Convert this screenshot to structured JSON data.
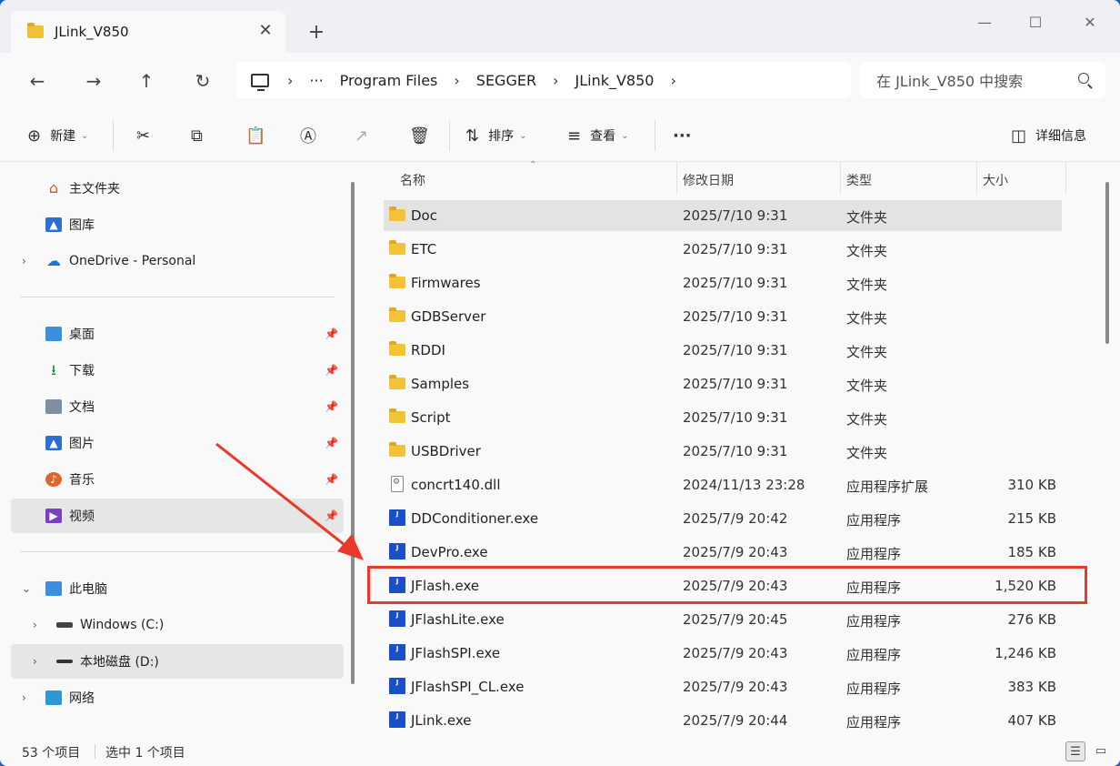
{
  "tab": {
    "title": "JLink_V850",
    "close": "✕",
    "new_tab": "+"
  },
  "window_controls": {
    "minimize": "—",
    "maximize": "☐",
    "close": "✕"
  },
  "nav": {
    "back": "←",
    "forward": "→",
    "up": "↑",
    "refresh": "↻"
  },
  "address": {
    "more": "···",
    "sep": "›",
    "crumbs": [
      "Program Files",
      "SEGGER",
      "JLink_V850"
    ]
  },
  "search": {
    "placeholder": "在 JLink_V850 中搜索"
  },
  "commands": {
    "new": "新建",
    "sort": "排序",
    "view": "查看",
    "more": "···",
    "details": "详细信息"
  },
  "sidebar": {
    "quick": [
      {
        "label": "主文件夹"
      },
      {
        "label": "图库"
      },
      {
        "label": "OneDrive - Personal"
      }
    ],
    "pinned": [
      {
        "label": "桌面"
      },
      {
        "label": "下载"
      },
      {
        "label": "文档"
      },
      {
        "label": "图片"
      },
      {
        "label": "音乐"
      },
      {
        "label": "视频"
      }
    ],
    "pc": [
      {
        "label": "此电脑"
      },
      {
        "label": "Windows (C:)"
      },
      {
        "label": "本地磁盘 (D:)"
      },
      {
        "label": "网络"
      }
    ]
  },
  "columns": {
    "name": "名称",
    "date": "修改日期",
    "type": "类型",
    "size": "大小"
  },
  "files": [
    {
      "name": "Doc",
      "date": "2025/7/10 9:31",
      "type": "文件夹",
      "size": "",
      "kind": "folder"
    },
    {
      "name": "ETC",
      "date": "2025/7/10 9:31",
      "type": "文件夹",
      "size": "",
      "kind": "folder"
    },
    {
      "name": "Firmwares",
      "date": "2025/7/10 9:31",
      "type": "文件夹",
      "size": "",
      "kind": "folder"
    },
    {
      "name": "GDBServer",
      "date": "2025/7/10 9:31",
      "type": "文件夹",
      "size": "",
      "kind": "folder"
    },
    {
      "name": "RDDI",
      "date": "2025/7/10 9:31",
      "type": "文件夹",
      "size": "",
      "kind": "folder"
    },
    {
      "name": "Samples",
      "date": "2025/7/10 9:31",
      "type": "文件夹",
      "size": "",
      "kind": "folder"
    },
    {
      "name": "Script",
      "date": "2025/7/10 9:31",
      "type": "文件夹",
      "size": "",
      "kind": "folder"
    },
    {
      "name": "USBDriver",
      "date": "2025/7/10 9:31",
      "type": "文件夹",
      "size": "",
      "kind": "folder"
    },
    {
      "name": "concrt140.dll",
      "date": "2024/11/13 23:28",
      "type": "应用程序扩展",
      "size": "310 KB",
      "kind": "dll"
    },
    {
      "name": "DDConditioner.exe",
      "date": "2025/7/9 20:42",
      "type": "应用程序",
      "size": "215 KB",
      "kind": "exe"
    },
    {
      "name": "DevPro.exe",
      "date": "2025/7/9 20:43",
      "type": "应用程序",
      "size": "185 KB",
      "kind": "exe"
    },
    {
      "name": "JFlash.exe",
      "date": "2025/7/9 20:43",
      "type": "应用程序",
      "size": "1,520 KB",
      "kind": "exe"
    },
    {
      "name": "JFlashLite.exe",
      "date": "2025/7/9 20:45",
      "type": "应用程序",
      "size": "276 KB",
      "kind": "exe"
    },
    {
      "name": "JFlashSPI.exe",
      "date": "2025/7/9 20:43",
      "type": "应用程序",
      "size": "1,246 KB",
      "kind": "exe"
    },
    {
      "name": "JFlashSPI_CL.exe",
      "date": "2025/7/9 20:43",
      "type": "应用程序",
      "size": "383 KB",
      "kind": "exe"
    },
    {
      "name": "JLink.exe",
      "date": "2025/7/9 20:44",
      "type": "应用程序",
      "size": "407 KB",
      "kind": "exe"
    }
  ],
  "status": {
    "count": "53 个项目",
    "selected": "选中 1 个项目"
  },
  "colors": {
    "accent": "#1a4fc8",
    "highlight": "#e8392a",
    "folder": "#f4c236"
  }
}
